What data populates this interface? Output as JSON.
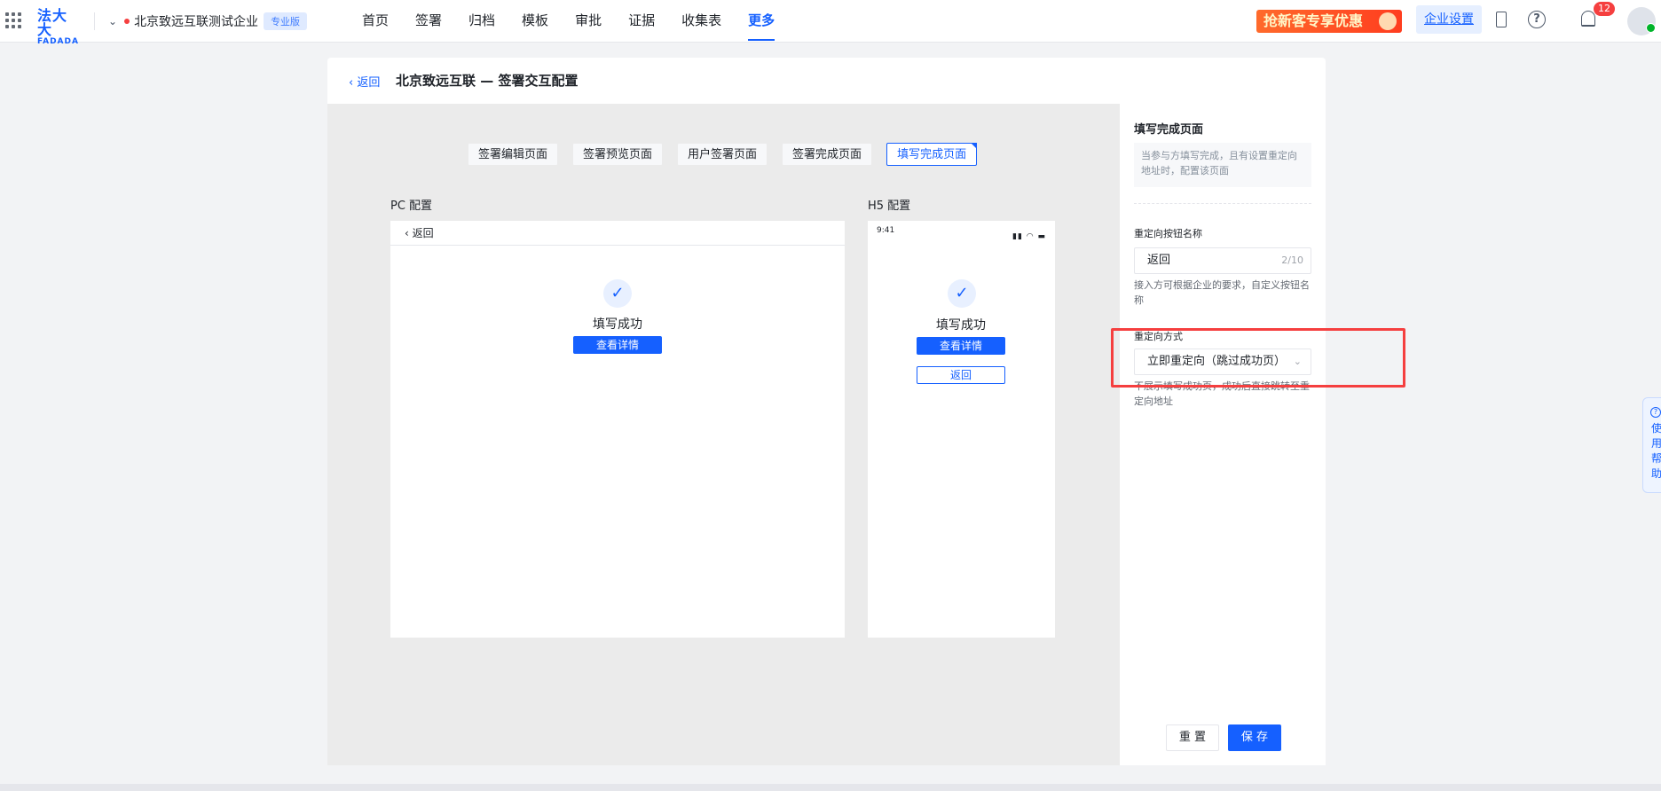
{
  "topbar": {
    "logo_zh": "法大大",
    "logo_en": "FADADA",
    "org_name": "北京致远互联测试企业",
    "org_badge": "专业版",
    "nav": [
      "首页",
      "签署",
      "归档",
      "模板",
      "审批",
      "证据",
      "收集表",
      "更多"
    ],
    "active_nav": "更多",
    "promo": "抢新客专享优惠",
    "enterprise_settings": "企业设置",
    "notification_count": "12"
  },
  "header": {
    "back": "返回",
    "title": "北京致远互联 — 签署交互配置"
  },
  "tabs": [
    "签署编辑页面",
    "签署预览页面",
    "用户签署页面",
    "签署完成页面",
    "填写完成页面"
  ],
  "active_tab": "填写完成页面",
  "preview": {
    "pc_label": "PC 配置",
    "h5_label": "H5 配置",
    "pc_back": "返回",
    "success_text": "填写成功",
    "view_details": "查看详情",
    "h5_time": "9:41",
    "h5_return": "返回"
  },
  "side": {
    "title": "填写完成页面",
    "note": "当参与方填写完成，且有设置重定向地址时，配置该页面",
    "btn_name_label": "重定向按钮名称",
    "btn_name_value": "返回",
    "btn_name_count": "2/10",
    "btn_name_hint": "接入方可根据企业的要求，自定义按钮名称",
    "redirect_label": "重定向方式",
    "redirect_value": "立即重定向（跳过成功页）",
    "redirect_hint": "不展示填写成功页，成功后直接跳转至重定向地址",
    "reset": "重 置",
    "save": "保 存"
  },
  "helper": {
    "text": "使用帮助"
  }
}
